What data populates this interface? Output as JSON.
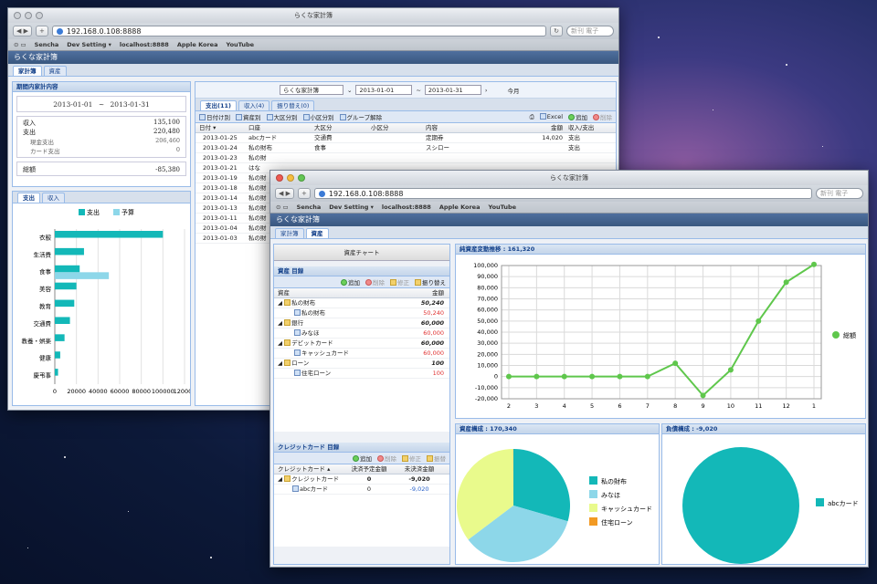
{
  "url": "192.168.0.108:8888",
  "window_title": "らくな家計簿",
  "search_placeholder": "新刊 電子",
  "bookmarks": [
    "Sencha",
    "Dev Setting ▾",
    "localhost:8888",
    "Apple Korea",
    "YouTube"
  ],
  "app_title": "らくな家計簿",
  "main_tabs": [
    "家計簿",
    "資産"
  ],
  "back_window": {
    "summary": {
      "title": "期間内家計内容",
      "period_start": "2013-01-01",
      "period_sep": "~",
      "period_end": "2013-01-31",
      "rows": [
        {
          "label": "収入",
          "value": "135,100"
        },
        {
          "label": "支出",
          "value": "220,480"
        },
        {
          "label": "現金支出",
          "value": "206,460"
        },
        {
          "label": "カード支出",
          "value": "0"
        }
      ],
      "total_label": "総額",
      "total_value": "-85,380"
    },
    "chart_tabs": [
      "支出",
      "収入"
    ],
    "chart_data": {
      "type": "bar",
      "orientation": "horizontal",
      "categories": [
        "衣服",
        "生活費",
        "食事",
        "美容",
        "教育",
        "交通費",
        "教養・娯楽",
        "健康",
        "慶弔事"
      ],
      "series": [
        {
          "name": "支出",
          "values": [
            100000,
            27000,
            23000,
            20000,
            18000,
            14000,
            9000,
            5000,
            3000
          ]
        },
        {
          "name": "予算",
          "values": [
            0,
            0,
            50000,
            0,
            0,
            0,
            0,
            0,
            0
          ]
        }
      ],
      "xticks": [
        "0",
        "20000",
        "40000",
        "60000",
        "80000",
        "100000",
        "120000"
      ],
      "xlim": [
        0,
        120000
      ]
    },
    "toolbar": {
      "account_select": "らくな家計簿",
      "date_from": "2013-01-01",
      "date_sep": "~",
      "date_to": "2013-01-31",
      "this_month": "今月"
    },
    "list_tabs": [
      "支出(11)",
      "収入(4)",
      "振り替え(0)"
    ],
    "list_toolbar": [
      "日付け別",
      "資産別",
      "大区分別",
      "小区分別",
      "グループ解除"
    ],
    "list_actions": [
      "Excel",
      "追加",
      "削除"
    ],
    "columns": [
      "日付 ▾",
      "口座",
      "大区分",
      "小区分",
      "内容",
      "金額",
      "収入/支出"
    ],
    "rows": [
      [
        "2013-01-25",
        "abcカード",
        "交通費",
        "",
        "定期券",
        "14,020",
        "支出"
      ],
      [
        "2013-01-24",
        "私の財布",
        "食事",
        "",
        "スシロー",
        "",
        "支出"
      ],
      [
        "2013-01-23",
        "私の財",
        "",
        "",
        "",
        "",
        ""
      ],
      [
        "2013-01-21",
        "はな",
        "",
        "",
        "",
        "",
        ""
      ],
      [
        "2013-01-19",
        "私の財",
        "",
        "",
        "",
        "",
        ""
      ],
      [
        "2013-01-18",
        "私の財",
        "",
        "",
        "",
        "",
        ""
      ],
      [
        "2013-01-14",
        "私の財",
        "",
        "",
        "",
        "",
        ""
      ],
      [
        "2013-01-13",
        "私の財",
        "",
        "",
        "",
        "",
        ""
      ],
      [
        "2013-01-11",
        "私の財",
        "",
        "",
        "",
        "",
        ""
      ],
      [
        "2013-01-04",
        "私の財",
        "",
        "",
        "",
        "",
        ""
      ],
      [
        "2013-01-03",
        "私の財",
        "",
        "",
        "",
        "",
        ""
      ]
    ]
  },
  "front_window": {
    "asset_chart_button": "資産チャート",
    "asset_list": {
      "title": "資産 目録",
      "actions": [
        "追加",
        "削除",
        "修正",
        "振り替え"
      ],
      "columns": [
        "資産",
        "金額"
      ],
      "rows": [
        {
          "name": "私の財布",
          "amount": "50,240",
          "level": 0
        },
        {
          "name": "私の財布",
          "amount": "50,240",
          "level": 1
        },
        {
          "name": "銀行",
          "amount": "60,000",
          "level": 0
        },
        {
          "name": "みなほ",
          "amount": "60,000",
          "level": 1
        },
        {
          "name": "デビットカード",
          "amount": "60,000",
          "level": 0
        },
        {
          "name": "キャッシュカード",
          "amount": "60,000",
          "level": 1
        },
        {
          "name": "ローン",
          "amount": "100",
          "level": 0
        },
        {
          "name": "住宅ローン",
          "amount": "100",
          "level": 1
        }
      ]
    },
    "credit_list": {
      "title": "クレジットカード 目録",
      "actions": [
        "追加",
        "削除",
        "修正",
        "振替"
      ],
      "columns": [
        "クレジットカード ▴",
        "決済予定金額",
        "未決済金額"
      ],
      "rows": [
        {
          "name": "クレジットカード",
          "planned": "0",
          "unpaid": "-9,020",
          "level": 0
        },
        {
          "name": "abcカード",
          "planned": "0",
          "unpaid": "-9,020",
          "level": 1
        }
      ]
    },
    "trend_title": "純資産変動推移 : 161,320",
    "chart_data": [
      {
        "type": "line",
        "title": "純資産変動推移 : 161,320",
        "x": [
          "2",
          "3",
          "4",
          "5",
          "6",
          "7",
          "8",
          "9",
          "10",
          "11",
          "12",
          "1"
        ],
        "series": [
          {
            "name": "総額",
            "values": [
              0,
              0,
              0,
              0,
              0,
              0,
              12000,
              -17000,
              6000,
              50000,
              85000,
              101000
            ]
          }
        ],
        "yticks": [
          "100,000",
          "90,000",
          "80,000",
          "70,000",
          "60,000",
          "50,000",
          "40,000",
          "30,000",
          "20,000",
          "10,000",
          "0",
          "-10,000",
          "-20,000"
        ],
        "ylim": [
          -20000,
          100000
        ],
        "legend": "right",
        "grid": true,
        "color": "#5fc74c"
      },
      {
        "type": "pie",
        "title": "資産構成 : 170,340",
        "slices": [
          {
            "name": "私の財布",
            "value": 50240,
            "color": "#13b8b8"
          },
          {
            "name": "みなほ",
            "value": 60000,
            "color": "#8dd7e9"
          },
          {
            "name": "キャッシュカード",
            "value": 60000,
            "color": "#e9fa8c"
          },
          {
            "name": "住宅ローン",
            "value": 100,
            "color": "#f29a24"
          }
        ]
      },
      {
        "type": "pie",
        "title": "負債構成 : -9,020",
        "slices": [
          {
            "name": "abcカード",
            "value": 9020,
            "color": "#13b8b8"
          }
        ]
      }
    ]
  }
}
